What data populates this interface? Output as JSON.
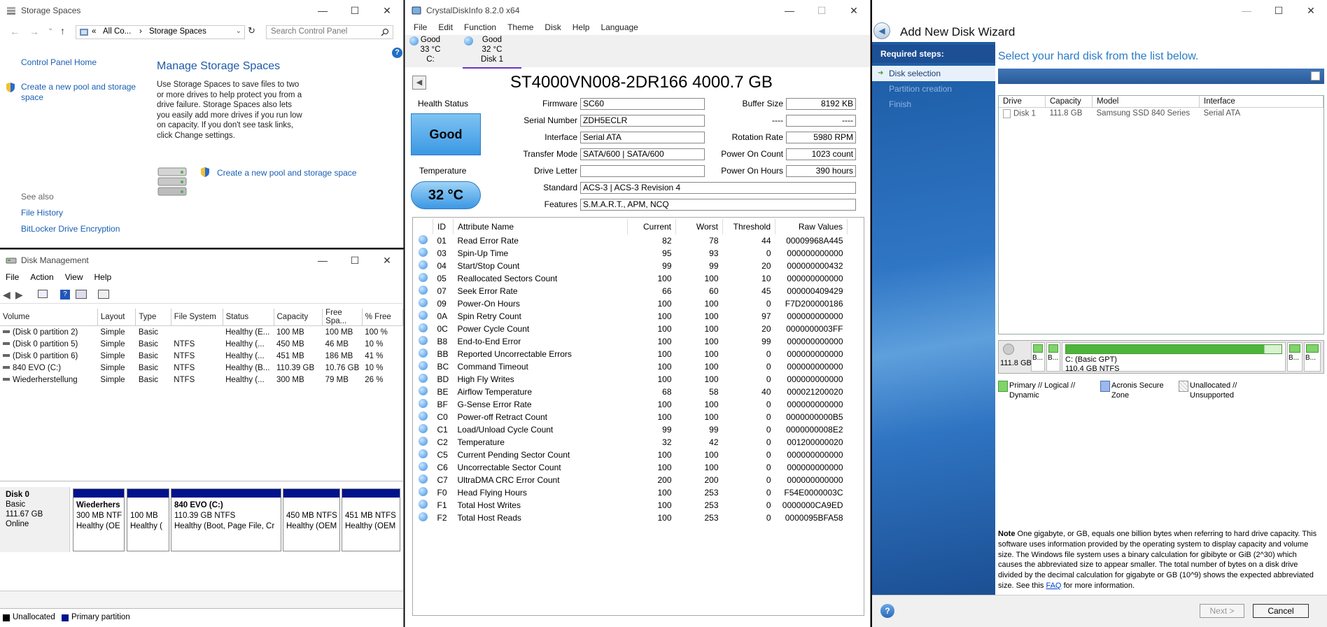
{
  "storage_spaces": {
    "title": "Storage Spaces",
    "breadcrumb": [
      "«",
      "All Co...",
      "›",
      "Storage Spaces"
    ],
    "search_placeholder": "Search Control Panel",
    "nav_home": "Control Panel Home",
    "nav_create": "Create a new pool and storage space",
    "heading": "Manage Storage Spaces",
    "description": "Use Storage Spaces to save files to two or more drives to help protect you from a drive failure. Storage Spaces also lets you easily add more drives if you run low on capacity. If you don't see task links, click Change settings.",
    "task_link": "Create a new pool and storage space",
    "see_also": "See also",
    "see_also_links": [
      "File History",
      "BitLocker Drive Encryption"
    ]
  },
  "disk_management": {
    "title": "Disk Management",
    "menu": [
      "File",
      "Action",
      "View",
      "Help"
    ],
    "columns": [
      "Volume",
      "Layout",
      "Type",
      "File System",
      "Status",
      "Capacity",
      "Free Spa...",
      "% Free"
    ],
    "rows": [
      [
        "(Disk 0 partition 2)",
        "Simple",
        "Basic",
        "",
        "Healthy (E...",
        "100 MB",
        "100 MB",
        "100 %"
      ],
      [
        "(Disk 0 partition 5)",
        "Simple",
        "Basic",
        "NTFS",
        "Healthy (...",
        "450 MB",
        "46 MB",
        "10 %"
      ],
      [
        "(Disk 0 partition 6)",
        "Simple",
        "Basic",
        "NTFS",
        "Healthy (...",
        "451 MB",
        "186 MB",
        "41 %"
      ],
      [
        "840 EVO (C:)",
        "Simple",
        "Basic",
        "NTFS",
        "Healthy (B...",
        "110.39 GB",
        "10.76 GB",
        "10 %"
      ],
      [
        "Wiederherstellung",
        "Simple",
        "Basic",
        "NTFS",
        "Healthy (...",
        "300 MB",
        "79 MB",
        "26 %"
      ]
    ],
    "disk": {
      "name": "Disk 0",
      "type": "Basic",
      "size": "111.67 GB",
      "state": "Online"
    },
    "partitions": [
      {
        "name": "Wiederhers",
        "size": "300 MB NTF",
        "status": "Healthy (OE"
      },
      {
        "name": "",
        "size": "100 MB",
        "status": "Healthy ("
      },
      {
        "name": "840 EVO  (C:)",
        "size": "110.39 GB NTFS",
        "status": "Healthy (Boot, Page File, Cr"
      },
      {
        "name": "",
        "size": "450 MB NTFS",
        "status": "Healthy (OEM"
      },
      {
        "name": "",
        "size": "451 MB NTFS",
        "status": "Healthy (OEM"
      }
    ],
    "legend": [
      "Unallocated",
      "Primary partition"
    ],
    "legend_colors": [
      "#000000",
      "#00128c"
    ]
  },
  "crystal": {
    "title": "CrystalDiskInfo 8.2.0 x64",
    "menu": [
      "File",
      "Edit",
      "Function",
      "Theme",
      "Disk",
      "Help",
      "Language"
    ],
    "drives": [
      {
        "status": "Good",
        "temp": "33 °C",
        "label": "C:"
      },
      {
        "status": "Good",
        "temp": "32 °C",
        "label": "Disk 1"
      }
    ],
    "model": "ST4000VN008-2DR166 4000.7 GB",
    "health_label": "Health Status",
    "health_value": "Good",
    "temp_label": "Temperature",
    "temp_value": "32 °C",
    "fields_left": [
      {
        "label": "Firmware",
        "value": "SC60"
      },
      {
        "label": "Serial Number",
        "value": "ZDH5ECLR"
      },
      {
        "label": "Interface",
        "value": "Serial ATA"
      },
      {
        "label": "Transfer Mode",
        "value": "SATA/600 | SATA/600"
      },
      {
        "label": "Drive Letter",
        "value": ""
      }
    ],
    "fields_right": [
      {
        "label": "Buffer Size",
        "value": "8192 KB"
      },
      {
        "label": "----",
        "value": "----"
      },
      {
        "label": "Rotation Rate",
        "value": "5980 RPM"
      },
      {
        "label": "Power On Count",
        "value": "1023 count"
      },
      {
        "label": "Power On Hours",
        "value": "390 hours"
      }
    ],
    "standard_label": "Standard",
    "standard_value": "ACS-3 | ACS-3 Revision 4",
    "features_label": "Features",
    "features_value": "S.M.A.R.T., APM, NCQ",
    "smart_columns": [
      "ID",
      "Attribute Name",
      "Current",
      "Worst",
      "Threshold",
      "Raw Values"
    ],
    "smart_rows": [
      [
        "01",
        "Read Error Rate",
        "82",
        "78",
        "44",
        "00009968A445"
      ],
      [
        "03",
        "Spin-Up Time",
        "95",
        "93",
        "0",
        "000000000000"
      ],
      [
        "04",
        "Start/Stop Count",
        "99",
        "99",
        "20",
        "000000000432"
      ],
      [
        "05",
        "Reallocated Sectors Count",
        "100",
        "100",
        "10",
        "000000000000"
      ],
      [
        "07",
        "Seek Error Rate",
        "66",
        "60",
        "45",
        "000000409429"
      ],
      [
        "09",
        "Power-On Hours",
        "100",
        "100",
        "0",
        "F7D200000186"
      ],
      [
        "0A",
        "Spin Retry Count",
        "100",
        "100",
        "97",
        "000000000000"
      ],
      [
        "0C",
        "Power Cycle Count",
        "100",
        "100",
        "20",
        "0000000003FF"
      ],
      [
        "B8",
        "End-to-End Error",
        "100",
        "100",
        "99",
        "000000000000"
      ],
      [
        "BB",
        "Reported Uncorrectable Errors",
        "100",
        "100",
        "0",
        "000000000000"
      ],
      [
        "BC",
        "Command Timeout",
        "100",
        "100",
        "0",
        "000000000000"
      ],
      [
        "BD",
        "High Fly Writes",
        "100",
        "100",
        "0",
        "000000000000"
      ],
      [
        "BE",
        "Airflow Temperature",
        "68",
        "58",
        "40",
        "000021200020"
      ],
      [
        "BF",
        "G-Sense Error Rate",
        "100",
        "100",
        "0",
        "000000000000"
      ],
      [
        "C0",
        "Power-off Retract Count",
        "100",
        "100",
        "0",
        "0000000000B5"
      ],
      [
        "C1",
        "Load/Unload Cycle Count",
        "99",
        "99",
        "0",
        "0000000008E2"
      ],
      [
        "C2",
        "Temperature",
        "32",
        "42",
        "0",
        "001200000020"
      ],
      [
        "C5",
        "Current Pending Sector Count",
        "100",
        "100",
        "0",
        "000000000000"
      ],
      [
        "C6",
        "Uncorrectable Sector Count",
        "100",
        "100",
        "0",
        "000000000000"
      ],
      [
        "C7",
        "UltraDMA CRC Error Count",
        "200",
        "200",
        "0",
        "000000000000"
      ],
      [
        "F0",
        "Head Flying Hours",
        "100",
        "253",
        "0",
        "F54E0000003C"
      ],
      [
        "F1",
        "Total Host Writes",
        "100",
        "253",
        "0",
        "0000000CA9ED"
      ],
      [
        "F2",
        "Total Host Reads",
        "100",
        "253",
        "0",
        "0000095BFA58"
      ]
    ]
  },
  "wizard": {
    "title": "Add New Disk Wizard",
    "required_steps": "Required steps:",
    "steps": [
      "Disk selection",
      "Partition creation",
      "Finish"
    ],
    "instruction": "Select your hard disk from the list below.",
    "columns": [
      "Drive",
      "Capacity",
      "Model",
      "Interface"
    ],
    "disks": [
      [
        "Disk 1",
        "111.8 GB",
        "Samsung SSD 840 Series",
        "Serial ATA"
      ]
    ],
    "disk_capacity": "111.8 GB",
    "small_parts": [
      "B...",
      "B...",
      "B...",
      "B..."
    ],
    "main_part_name": "C: (Basic GPT)",
    "main_part_size": "110.4 GB  NTFS",
    "legend": [
      "Primary // Logical // Dynamic",
      "Acronis Secure Zone",
      "Unallocated // Unsupported"
    ],
    "note_label": "Note",
    "note_text": "One gigabyte, or GB, equals one billion bytes when referring to hard drive capacity. This software uses information provided by the operating system to display capacity and volume size. The Windows file system uses a binary calculation for gibibyte or GiB (2^30) which causes the abbreviated size to appear smaller. The total number of bytes on a disk drive divided by the decimal calculation for gigabyte or GB (10^9) shows the expected abbreviated size. See this",
    "note_link": "FAQ",
    "note_tail": "for more information.",
    "next": "Next >",
    "cancel": "Cancel"
  }
}
